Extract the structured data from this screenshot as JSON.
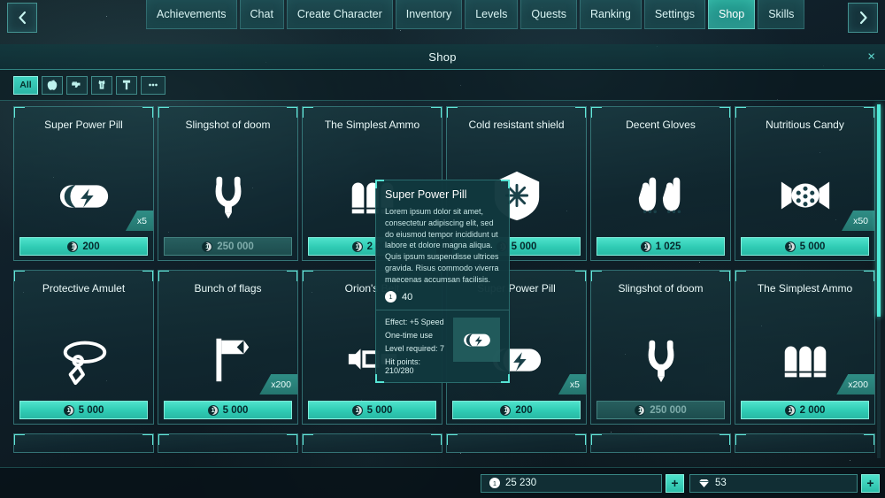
{
  "nav": {
    "prev_label": "chevron-left",
    "next_label": "chevron-right",
    "tabs": [
      {
        "label": "Achievements",
        "active": false
      },
      {
        "label": "Chat",
        "active": false
      },
      {
        "label": "Create Character",
        "active": false
      },
      {
        "label": "Inventory",
        "active": false
      },
      {
        "label": "Levels",
        "active": false
      },
      {
        "label": "Quests",
        "active": false
      },
      {
        "label": "Ranking",
        "active": false
      },
      {
        "label": "Settings",
        "active": false
      },
      {
        "label": "Shop",
        "active": true
      },
      {
        "label": "Skills",
        "active": false
      }
    ]
  },
  "panel": {
    "title": "Shop",
    "close_label": "×"
  },
  "filters": [
    {
      "label": "All",
      "icon": "all-filter",
      "active": true
    },
    {
      "label": "",
      "icon": "apple-icon",
      "active": false
    },
    {
      "label": "",
      "icon": "gun-icon",
      "active": false
    },
    {
      "label": "",
      "icon": "armor-icon",
      "active": false
    },
    {
      "label": "",
      "icon": "hammer-icon",
      "active": false
    },
    {
      "label": "•••",
      "icon": "more-icon",
      "active": false
    }
  ],
  "items": [
    {
      "title": "Super Power Pill",
      "icon": "pill-icon",
      "price": "200",
      "qty": "x5",
      "affordable": true
    },
    {
      "title": "Slingshot of doom",
      "icon": "slingshot-icon",
      "price": "250 000",
      "qty": "",
      "affordable": false
    },
    {
      "title": "The Simplest Ammo",
      "icon": "ammo-icon",
      "price": "2 000",
      "qty": "",
      "affordable": true
    },
    {
      "title": "Cold resistant shield",
      "icon": "shield-icon",
      "price": "5 000",
      "qty": "",
      "affordable": true
    },
    {
      "title": "Decent Gloves",
      "icon": "gloves-icon",
      "price": "1 025",
      "qty": "",
      "affordable": true
    },
    {
      "title": "Nutritious Candy",
      "icon": "candy-icon",
      "price": "5 000",
      "qty": "x50",
      "affordable": true
    },
    {
      "title": "Protective Amulet",
      "icon": "amulet-icon",
      "price": "5 000",
      "qty": "",
      "affordable": true
    },
    {
      "title": "Bunch of flags",
      "icon": "flag-icon",
      "price": "5 000",
      "qty": "x200",
      "affordable": true
    },
    {
      "title": "Orion's Belt",
      "icon": "belt-icon",
      "price": "5 000",
      "qty": "",
      "affordable": true
    },
    {
      "title": "Super Power Pill",
      "icon": "pill-icon",
      "price": "200",
      "qty": "x5",
      "affordable": true
    },
    {
      "title": "Slingshot of doom",
      "icon": "slingshot-icon",
      "price": "250 000",
      "qty": "",
      "affordable": false
    },
    {
      "title": "The Simplest Ammo",
      "icon": "ammo-icon",
      "price": "2 000",
      "qty": "x200",
      "affordable": true
    }
  ],
  "tooltip": {
    "title": "Super Power Pill",
    "description": "Lorem ipsum dolor sit amet, consectetur adipiscing elit, sed do eiusmod tempor incididunt ut labore et dolore magna aliqua. Quis ipsum suspendisse ultrices gravida. Risus commodo viverra maecenas accumsan facilisis.",
    "price": "40",
    "stats": [
      "Effect: +5 Speed",
      "One-time use",
      "Level required: 7",
      "Hit points: 210/280"
    ],
    "thumb_icon": "pill-icon"
  },
  "currency": {
    "coins": "25 230",
    "coins_add_label": "+",
    "gems": "53",
    "gems_add_label": "+"
  },
  "colors": {
    "accent": "#3fd3c0",
    "accent_bright": "#4fe8d6",
    "panel_dark": "#11383e",
    "text": "#eafbfa"
  }
}
